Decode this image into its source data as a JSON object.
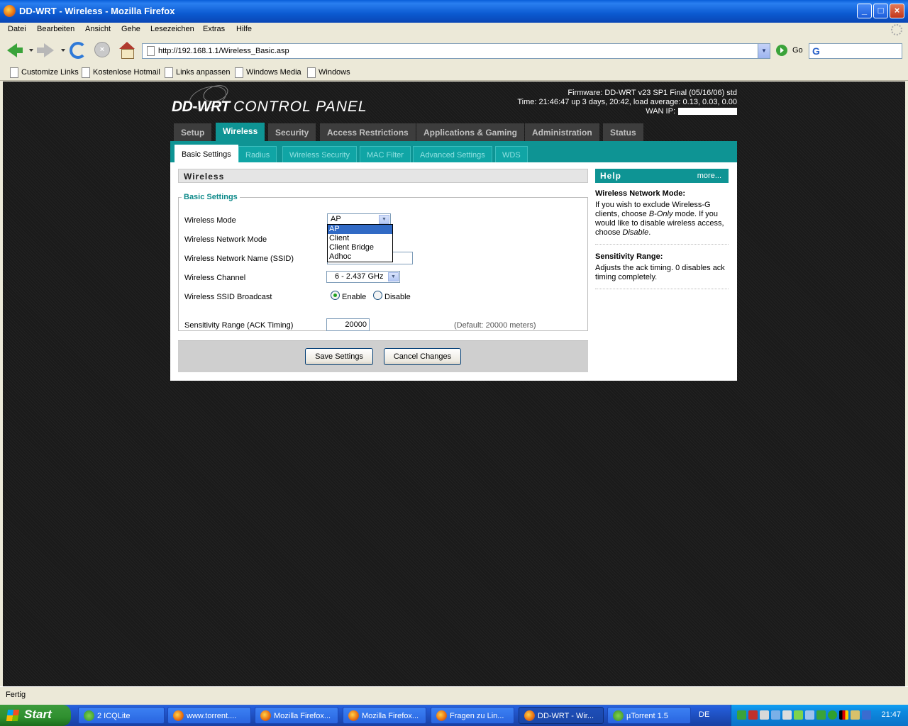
{
  "window": {
    "title": "DD-WRT - Wireless - Mozilla Firefox",
    "buttons": {
      "minimize": "_",
      "maximize": "□",
      "close": "×"
    }
  },
  "menu": [
    "Datei",
    "Bearbeiten",
    "Ansicht",
    "Gehe",
    "Lesezeichen",
    "Extras",
    "Hilfe"
  ],
  "navbar": {
    "url": "http://192.168.1.1/Wireless_Basic.asp",
    "go_label": "Go",
    "stop_glyph": "×"
  },
  "bookmarks": [
    "Customize Links",
    "Kostenlose Hotmail",
    "Links anpassen",
    "Windows Media",
    "Windows"
  ],
  "router": {
    "logo_brand": "DD-WRT",
    "logo_sub": "CONTROL PANEL",
    "firmware": "Firmware: DD-WRT v23 SP1 Final (05/16/06) std",
    "time": "Time: 21:46:47 up 3 days, 20:42, load average: 0.13, 0.03, 0.00",
    "wan_ip_label": "WAN IP:",
    "main_tabs": [
      "Setup",
      "Wireless",
      "Security",
      "Access Restrictions",
      "Applications & Gaming",
      "Administration",
      "Status"
    ],
    "active_main_tab": "Wireless",
    "sub_tabs": [
      "Basic Settings",
      "Radius",
      "Wireless Security",
      "MAC Filter",
      "Advanced Settings",
      "WDS"
    ],
    "active_sub_tab": "Basic Settings"
  },
  "form": {
    "section_title": "Wireless",
    "legend": "Basic Settings",
    "wireless_mode_label": "Wireless Mode",
    "wireless_mode_value": "AP",
    "wireless_mode_options": [
      "AP",
      "Client",
      "Client Bridge",
      "Adhoc"
    ],
    "network_mode_label": "Wireless Network Mode",
    "ssid_label": "Wireless Network Name (SSID)",
    "channel_label": "Wireless Channel",
    "channel_value": "6 - 2.437 GHz",
    "ssid_broadcast_label": "Wireless SSID Broadcast",
    "enable_label": "Enable",
    "disable_label": "Disable",
    "ssid_broadcast_value": "Enable",
    "sensitivity_label": "Sensitivity Range (ACK Timing)",
    "sensitivity_value": "20000",
    "sensitivity_default": "(Default: 20000 meters)",
    "save_button": "Save Settings",
    "cancel_button": "Cancel Changes"
  },
  "help": {
    "title": "Help",
    "more": "more...",
    "items": [
      {
        "heading": "Wireless Network Mode:",
        "text_a": "If you wish to exclude Wireless-G clients, choose ",
        "text_b": "B-Only",
        "text_c": " mode. If you would like to disable wireless access, choose ",
        "text_d": "Disable",
        "text_e": "."
      },
      {
        "heading": "Sensitivity Range:",
        "text": "Adjusts the ack timing. 0 disables ack timing completely."
      }
    ]
  },
  "statusbar": {
    "text": "Fertig"
  },
  "taskbar": {
    "start": "Start",
    "tasks": [
      "2 ICQLite",
      "www.torrent....",
      "Mozilla Firefox...",
      "Mozilla Firefox...",
      "Fragen zu Lin...",
      "DD-WRT - Wir...",
      "µTorrent 1.5"
    ],
    "active_task": "DD-WRT - Wir...",
    "language": "DE",
    "clock": "21:47"
  },
  "colors": {
    "accent_teal": "#0e9494",
    "xp_blue": "#245edb",
    "page_bg": "#1a1a1a",
    "highlight": "#316ac5"
  }
}
